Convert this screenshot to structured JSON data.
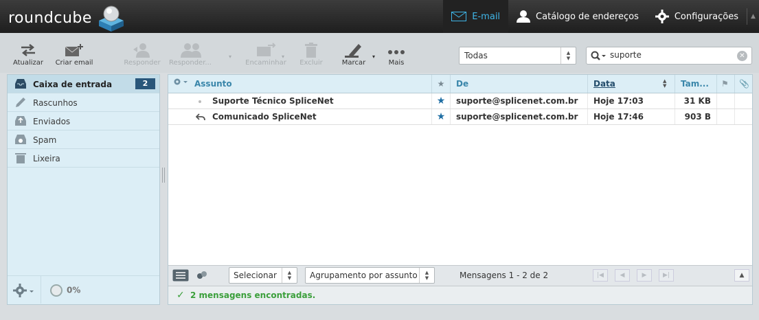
{
  "header": {
    "logo": "roundcube",
    "nav": [
      {
        "label": "E-mail",
        "icon": "envelope-icon",
        "active": true
      },
      {
        "label": "Catálogo de endereços",
        "icon": "contact-icon",
        "active": false
      },
      {
        "label": "Configurações",
        "icon": "gear-icon",
        "active": false
      }
    ]
  },
  "toolbar": {
    "buttons": [
      {
        "label": "Atualizar",
        "icon": "refresh-icon",
        "enabled": true
      },
      {
        "label": "Criar email",
        "icon": "compose-icon",
        "enabled": true
      },
      {
        "label": "Responder",
        "icon": "reply-icon",
        "enabled": false
      },
      {
        "label": "Responder...",
        "icon": "reply-all-icon",
        "enabled": false
      },
      {
        "label": "Encaminhar",
        "icon": "forward-icon",
        "enabled": false
      },
      {
        "label": "Excluir",
        "icon": "trash-icon",
        "enabled": false
      },
      {
        "label": "Marcar",
        "icon": "marker-icon",
        "enabled": true
      },
      {
        "label": "Mais",
        "icon": "more-icon",
        "enabled": true
      }
    ],
    "filter": "Todas",
    "search_value": "suporte"
  },
  "folders": [
    {
      "label": "Caixa de entrada",
      "icon": "inbox-icon",
      "unread": "2",
      "selected": true
    },
    {
      "label": "Rascunhos",
      "icon": "drafts-icon",
      "unread": "",
      "selected": false
    },
    {
      "label": "Enviados",
      "icon": "sent-icon",
      "unread": "",
      "selected": false
    },
    {
      "label": "Spam",
      "icon": "spam-icon",
      "unread": "",
      "selected": false
    },
    {
      "label": "Lixeira",
      "icon": "trash-icon",
      "unread": "",
      "selected": false
    }
  ],
  "quota": "0%",
  "list": {
    "columns": {
      "subject": "Assunto",
      "from": "De",
      "date": "Data",
      "size": "Tam..."
    },
    "rows": [
      {
        "subject": "Suporte Técnico SpliceNet",
        "from": "suporte@splicenet.com.br",
        "date": "Hoje 17:03",
        "size": "31 KB",
        "replied": false
      },
      {
        "subject": "Comunicado SpliceNet",
        "from": "suporte@splicenet.com.br",
        "date": "Hoje 17:46",
        "size": "903 B",
        "replied": true
      }
    ],
    "select_label": "Selecionar",
    "threading_label": "Agrupamento por assunto",
    "count_text": "Mensagens 1 - 2 de 2",
    "status_message": "2 mensagens encontradas."
  },
  "colors": {
    "accent": "#3fb6e8",
    "badge": "#29567a",
    "star": "#1f6ea3",
    "success": "#3b9f3b"
  }
}
